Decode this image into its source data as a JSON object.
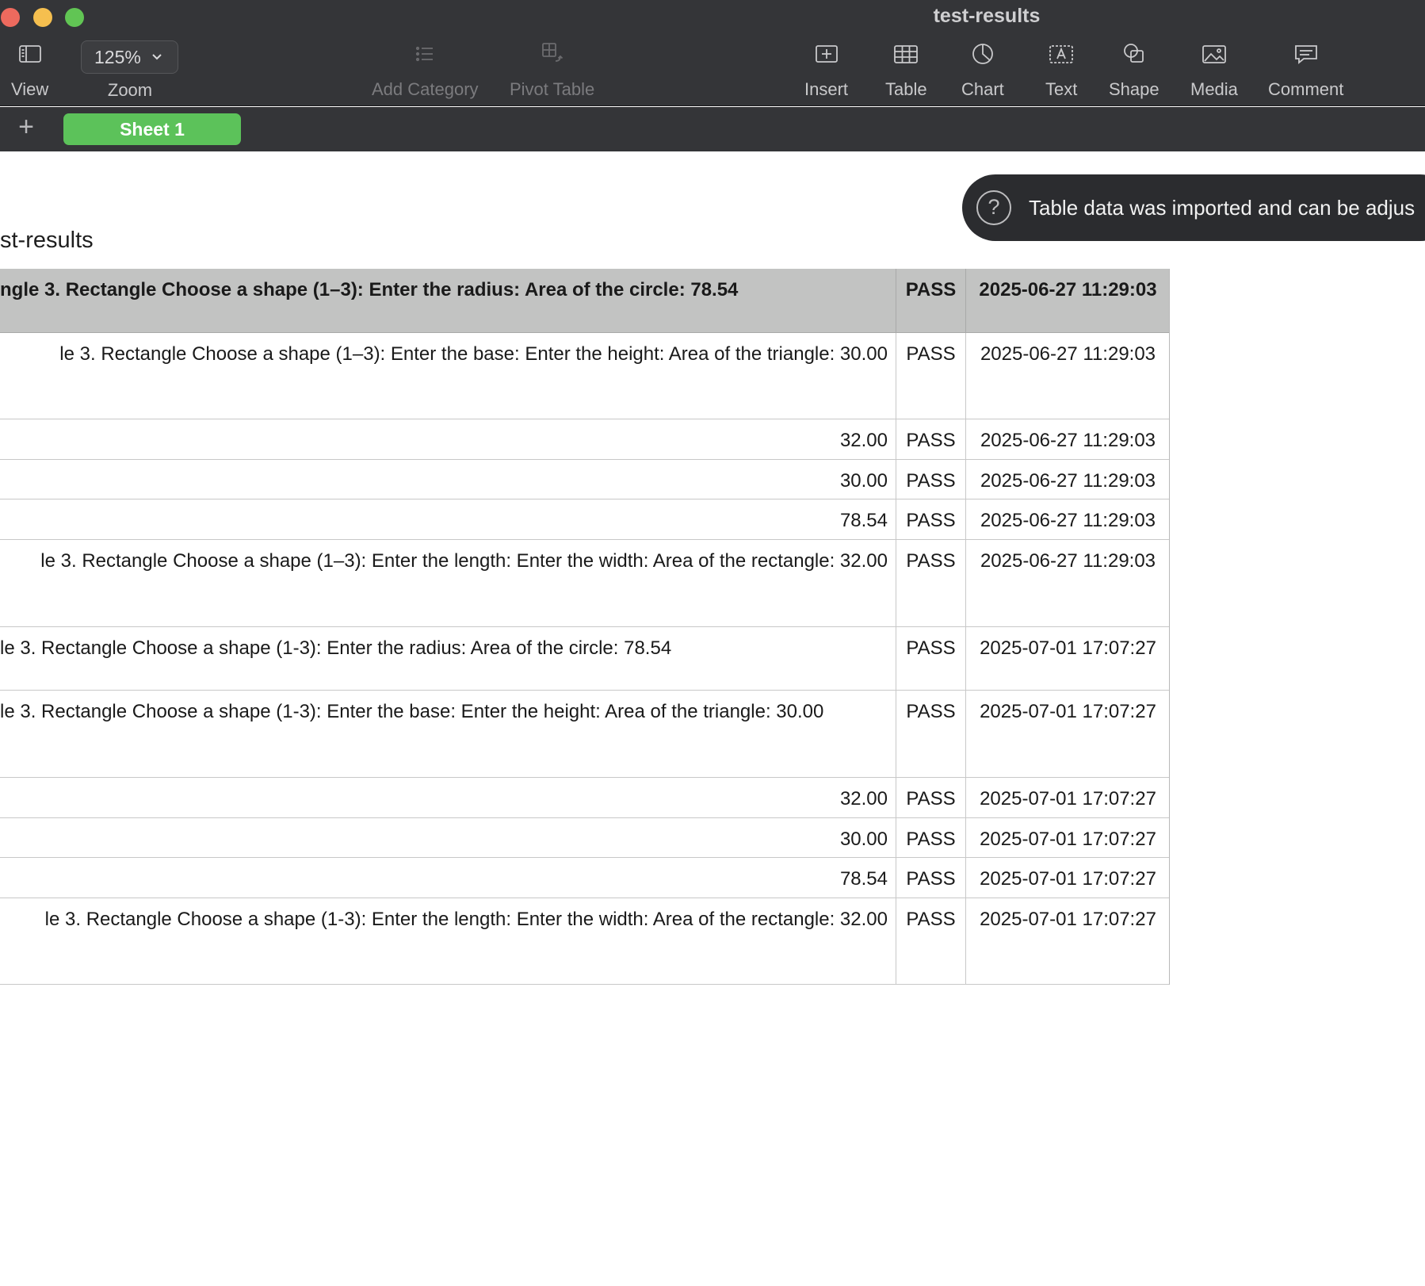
{
  "window": {
    "title": "test-results"
  },
  "toolbar": {
    "view_label": "View",
    "zoom_value": "125%",
    "zoom_label": "Zoom",
    "add_category_label": "Add Category",
    "pivot_table_label": "Pivot Table",
    "insert_label": "Insert",
    "table_label": "Table",
    "chart_label": "Chart",
    "text_label": "Text",
    "shape_label": "Shape",
    "media_label": "Media",
    "comment_label": "Comment"
  },
  "sheets": {
    "add_symbol": "+",
    "active_tab": "Sheet 1"
  },
  "notice": {
    "icon": "?",
    "text": "Table data was imported and can be adjus"
  },
  "table": {
    "title": "st-results",
    "rows": [
      {
        "a": "ngle 3. Rectangle Choose a shape (1–3):  Enter the radius: Area of the circle: 78.54",
        "b": "PASS",
        "c": "2025-06-27 11:29:03"
      },
      {
        "a": "le 3. Rectangle Choose a shape (1–3):  Enter the base: Enter the height: Area of the triangle: 30.00",
        "b": "PASS",
        "c": "2025-06-27 11:29:03"
      },
      {
        "a": "32.00",
        "b": "PASS",
        "c": "2025-06-27 11:29:03"
      },
      {
        "a": "30.00",
        "b": "PASS",
        "c": "2025-06-27 11:29:03"
      },
      {
        "a": "78.54",
        "b": "PASS",
        "c": "2025-06-27 11:29:03"
      },
      {
        "a": "le 3. Rectangle Choose a shape (1–3):  Enter the length: Enter the width: Area of the rectangle: 32.00",
        "b": "PASS",
        "c": "2025-06-27 11:29:03"
      },
      {
        "a": "le 3. Rectangle Choose a shape (1-3):  Enter the radius: Area of the circle: 78.54",
        "b": "PASS",
        "c": "2025-07-01 17:07:27"
      },
      {
        "a": "le 3. Rectangle Choose a shape (1-3):  Enter the base: Enter the height: Area of the triangle: 30.00",
        "b": "PASS",
        "c": "2025-07-01 17:07:27"
      },
      {
        "a": "32.00",
        "b": "PASS",
        "c": "2025-07-01 17:07:27"
      },
      {
        "a": "30.00",
        "b": "PASS",
        "c": "2025-07-01 17:07:27"
      },
      {
        "a": "78.54",
        "b": "PASS",
        "c": "2025-07-01 17:07:27"
      },
      {
        "a": "le 3. Rectangle Choose a shape (1-3):  Enter the length: Enter the width: Area of the rectangle: 32.00",
        "b": "PASS",
        "c": "2025-07-01 17:07:27"
      }
    ]
  }
}
